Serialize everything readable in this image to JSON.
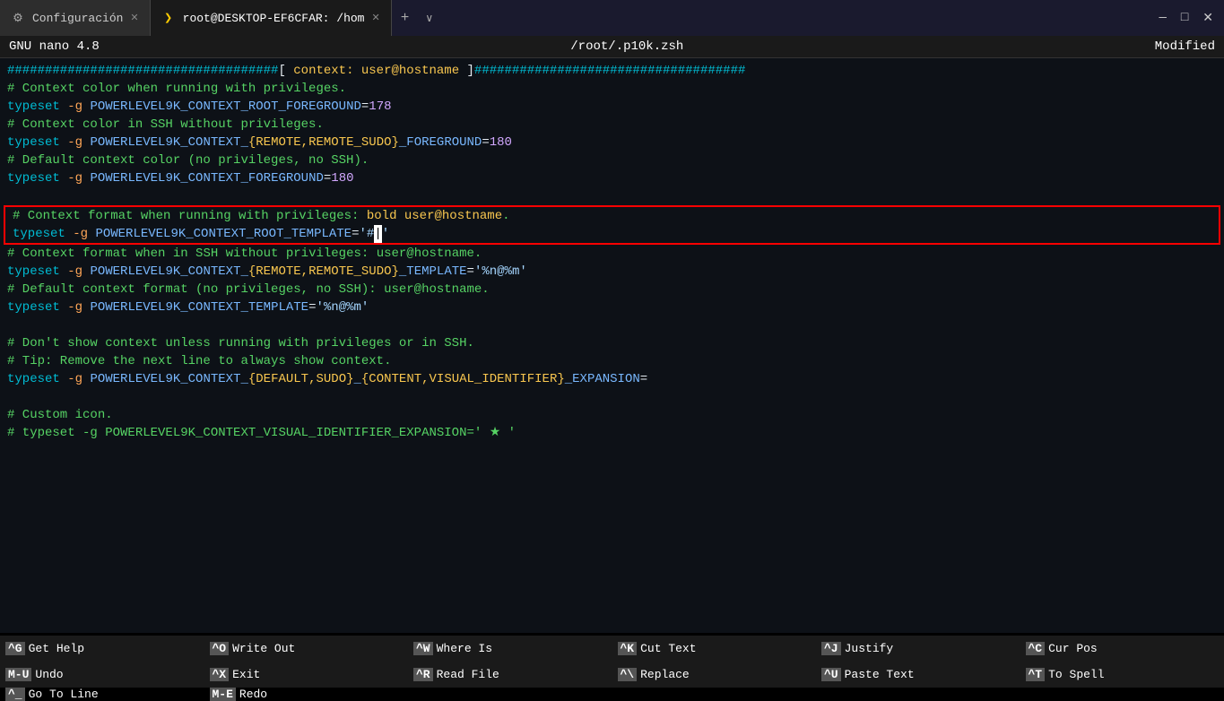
{
  "titlebar": {
    "tabs": [
      {
        "id": "configuracion",
        "label": "Configuración",
        "icon": "gear",
        "active": false,
        "closable": true
      },
      {
        "id": "terminal",
        "label": "root@DESKTOP-EF6CFAR: /hom",
        "icon": "terminal",
        "active": true,
        "closable": true
      }
    ],
    "new_tab": "+",
    "chevron": "∨",
    "controls": [
      "—",
      "□",
      "✕"
    ]
  },
  "nano_header": {
    "app": "GNU nano 4.8",
    "file": "/root/.p10k.zsh",
    "status": "Modified"
  },
  "editor": {
    "lines": [
      {
        "content": "####################################[ context: user@hostname ]####################################",
        "type": "comment-hash"
      },
      {
        "content": "# Context color when running with privileges.",
        "type": "comment"
      },
      {
        "content": "typeset -g POWERLEVEL9K_CONTEXT_ROOT_FOREGROUND=178",
        "type": "code"
      },
      {
        "content": "# Context color in SSH without privileges.",
        "type": "comment"
      },
      {
        "content": "typeset -g POWERLEVEL9K_CONTEXT_{REMOTE,REMOTE_SUDO}_FOREGROUND=180",
        "type": "code"
      },
      {
        "content": "# Default context color (no privileges, no SSH).",
        "type": "comment"
      },
      {
        "content": "typeset -g POWERLEVEL9K_CONTEXT_FOREGROUND=180",
        "type": "code"
      },
      {
        "content": "",
        "type": "empty"
      },
      {
        "content": "# Context format when running with privileges: bold user@hostname.",
        "type": "comment",
        "highlighted": true
      },
      {
        "content": "typeset -g POWERLEVEL9K_CONTEXT_ROOT_TEMPLATE='#|'",
        "type": "code",
        "highlighted": true
      },
      {
        "content": "# Context format when in SSH without privileges: user@hostname.",
        "type": "comment"
      },
      {
        "content": "typeset -g POWERLEVEL9K_CONTEXT_{REMOTE,REMOTE_SUDO}_TEMPLATE='%n@%m'",
        "type": "code"
      },
      {
        "content": "# Default context format (no privileges, no SSH): user@hostname.",
        "type": "comment"
      },
      {
        "content": "typeset -g POWERLEVEL9K_CONTEXT_TEMPLATE='%n@%m'",
        "type": "code"
      },
      {
        "content": "",
        "type": "empty"
      },
      {
        "content": "# Don't show context unless running with privileges or in SSH.",
        "type": "comment"
      },
      {
        "content": "# Tip: Remove the next line to always show context.",
        "type": "comment"
      },
      {
        "content": "typeset -g POWERLEVEL9K_CONTEXT_{DEFAULT,SUDO}_{CONTENT,VISUAL_IDENTIFIER}_EXPANSION=",
        "type": "code"
      },
      {
        "content": "",
        "type": "empty"
      },
      {
        "content": "# Custom icon.",
        "type": "comment"
      },
      {
        "content": "# typeset -g POWERLEVEL9K_CONTEXT_VISUAL_IDENTIFIER_EXPANSION=' ★ '",
        "type": "comment"
      }
    ]
  },
  "bottom_bar": {
    "shortcuts": [
      {
        "key": "^G",
        "label": "Get Help"
      },
      {
        "key": "^O",
        "label": "Write Out"
      },
      {
        "key": "^W",
        "label": "Where Is"
      },
      {
        "key": "^K",
        "label": "Cut Text"
      },
      {
        "key": "^J",
        "label": "Justify"
      },
      {
        "key": "^C",
        "label": "Cur Pos"
      },
      {
        "key": "M-U",
        "label": "Undo"
      },
      {
        "key": "^X",
        "label": "Exit"
      },
      {
        "key": "^R",
        "label": "Read File"
      },
      {
        "key": "^\\",
        "label": "Replace"
      },
      {
        "key": "^U",
        "label": "Paste Text"
      },
      {
        "key": "^T",
        "label": "To Spell"
      },
      {
        "key": "^_",
        "label": "Go To Line"
      },
      {
        "key": "M-E",
        "label": "Redo"
      }
    ]
  }
}
